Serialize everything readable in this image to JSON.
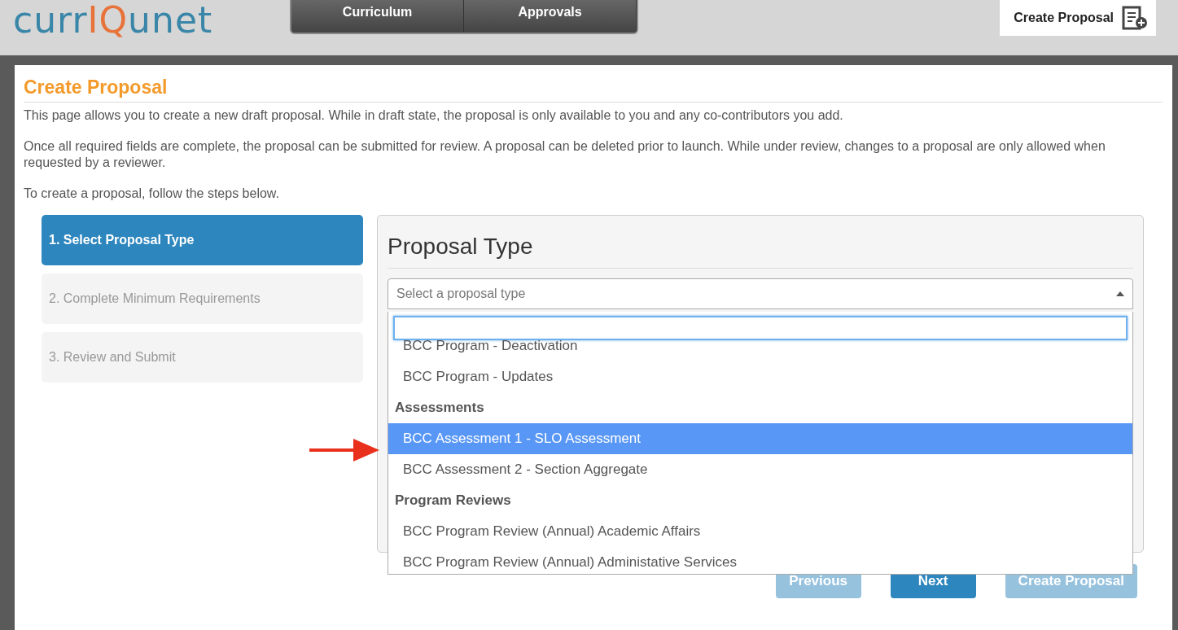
{
  "logo": {
    "parts": [
      {
        "text": "curr",
        "accent": false
      },
      {
        "text": "I",
        "accent": true
      },
      {
        "text": "Q",
        "accent": true
      },
      {
        "text": "unet",
        "accent": false
      }
    ]
  },
  "nav": {
    "tabs": [
      {
        "label": "Curriculum",
        "selected": false
      },
      {
        "label": "Approvals",
        "selected": false
      }
    ]
  },
  "header_action": {
    "label": "Create Proposal"
  },
  "page": {
    "title": "Create Proposal",
    "paragraphs": [
      "This page allows you to create a new draft proposal. While in draft state, the proposal is only available to you and any co-contributors you add.",
      "Once all required fields are complete, the proposal can be submitted for review. A proposal can be deleted prior to launch. While under review, changes to a proposal are only allowed when requested by a reviewer.",
      "To create a proposal, follow the steps below."
    ]
  },
  "steps": [
    {
      "label": "1. Select Proposal Type",
      "selected": true
    },
    {
      "label": "2. Complete Minimum Requirements",
      "selected": false
    },
    {
      "label": "3. Review and Submit",
      "selected": false
    }
  ],
  "proposal_type": {
    "heading": "Proposal Type",
    "select": {
      "placeholder": "Select a proposal type",
      "expanded": true
    },
    "options": [
      {
        "kind": "option",
        "label": "BCC Program - Deactivation",
        "selected": false
      },
      {
        "kind": "option",
        "label": "BCC Program - Updates",
        "selected": false
      },
      {
        "kind": "group",
        "label": "Assessments"
      },
      {
        "kind": "option",
        "label": "BCC Assessment 1 - SLO Assessment",
        "selected": true
      },
      {
        "kind": "option",
        "label": "BCC Assessment 2 - Section Aggregate",
        "selected": false
      },
      {
        "kind": "group",
        "label": "Program Reviews"
      },
      {
        "kind": "option",
        "label": "BCC Program Review (Annual) Academic Affairs",
        "selected": false
      },
      {
        "kind": "option",
        "label": "BCC Program Review (Annual) Administative Services",
        "selected": false
      }
    ]
  },
  "buttons": [
    {
      "label": "Previous",
      "disabled": true
    },
    {
      "label": "Next",
      "disabled": false
    },
    {
      "label": "Create Proposal",
      "disabled": true
    }
  ]
}
